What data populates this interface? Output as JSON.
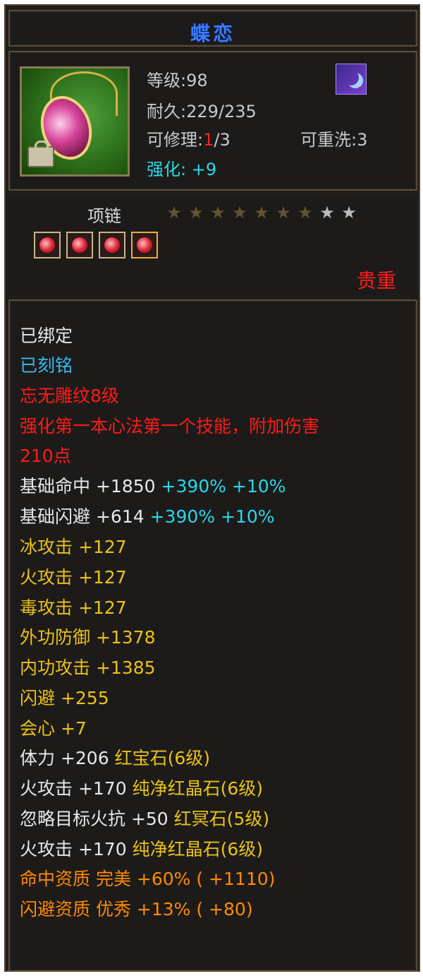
{
  "title": "蝶恋",
  "header": {
    "level": "等级:98",
    "durability": "耐久:229/235",
    "repair_label": "可修理:",
    "repair_current": "1",
    "repair_total": "/3",
    "rewash": "可重洗:3",
    "enhance": "强化: +9"
  },
  "sub": {
    "type": "项链",
    "stars_filled": 7,
    "stars_total": 9,
    "precious": "贵重"
  },
  "details": {
    "bound": "已绑定",
    "engraved": "已刻铭",
    "pattern": "忘无雕纹8级",
    "skill_line1": "强化第一本心法第一个技能，附加伤害",
    "skill_line2": "210点",
    "base_hit": "基础命中",
    "base_hit_value": "+1850",
    "base_hit_pct1": "+390%",
    "base_hit_pct2": "+10%",
    "base_dodge": "基础闪避",
    "base_dodge_value": "+614",
    "base_dodge_pct1": "+390%",
    "base_dodge_pct2": "+10%",
    "attrs": [
      "冰攻击 +127",
      "火攻击 +127",
      "毒攻击 +127",
      "外功防御 +1378",
      "内功攻击 +1385",
      "闪避 +255",
      "会心 +7"
    ],
    "gem_lines": [
      {
        "stat": "体力 +206",
        "gem": "红宝石(6级)"
      },
      {
        "stat": "火攻击 +170",
        "gem": "纯净红晶石(6级)"
      },
      {
        "stat": "忽略目标火抗 +50",
        "gem": "红冥石(5级)"
      },
      {
        "stat": "火攻击 +170",
        "gem": "纯净红晶石(6级)"
      }
    ],
    "aptitudes": [
      "命中资质  完美 +60% ( +1110)",
      "闪避资质  优秀 +13% ( +80)"
    ]
  },
  "colors": {
    "title": "#3a7bff",
    "cyan": "#28d8ea",
    "red": "#ff1a1a",
    "yellow": "#e8c21a",
    "orange": "#ff8a00"
  }
}
